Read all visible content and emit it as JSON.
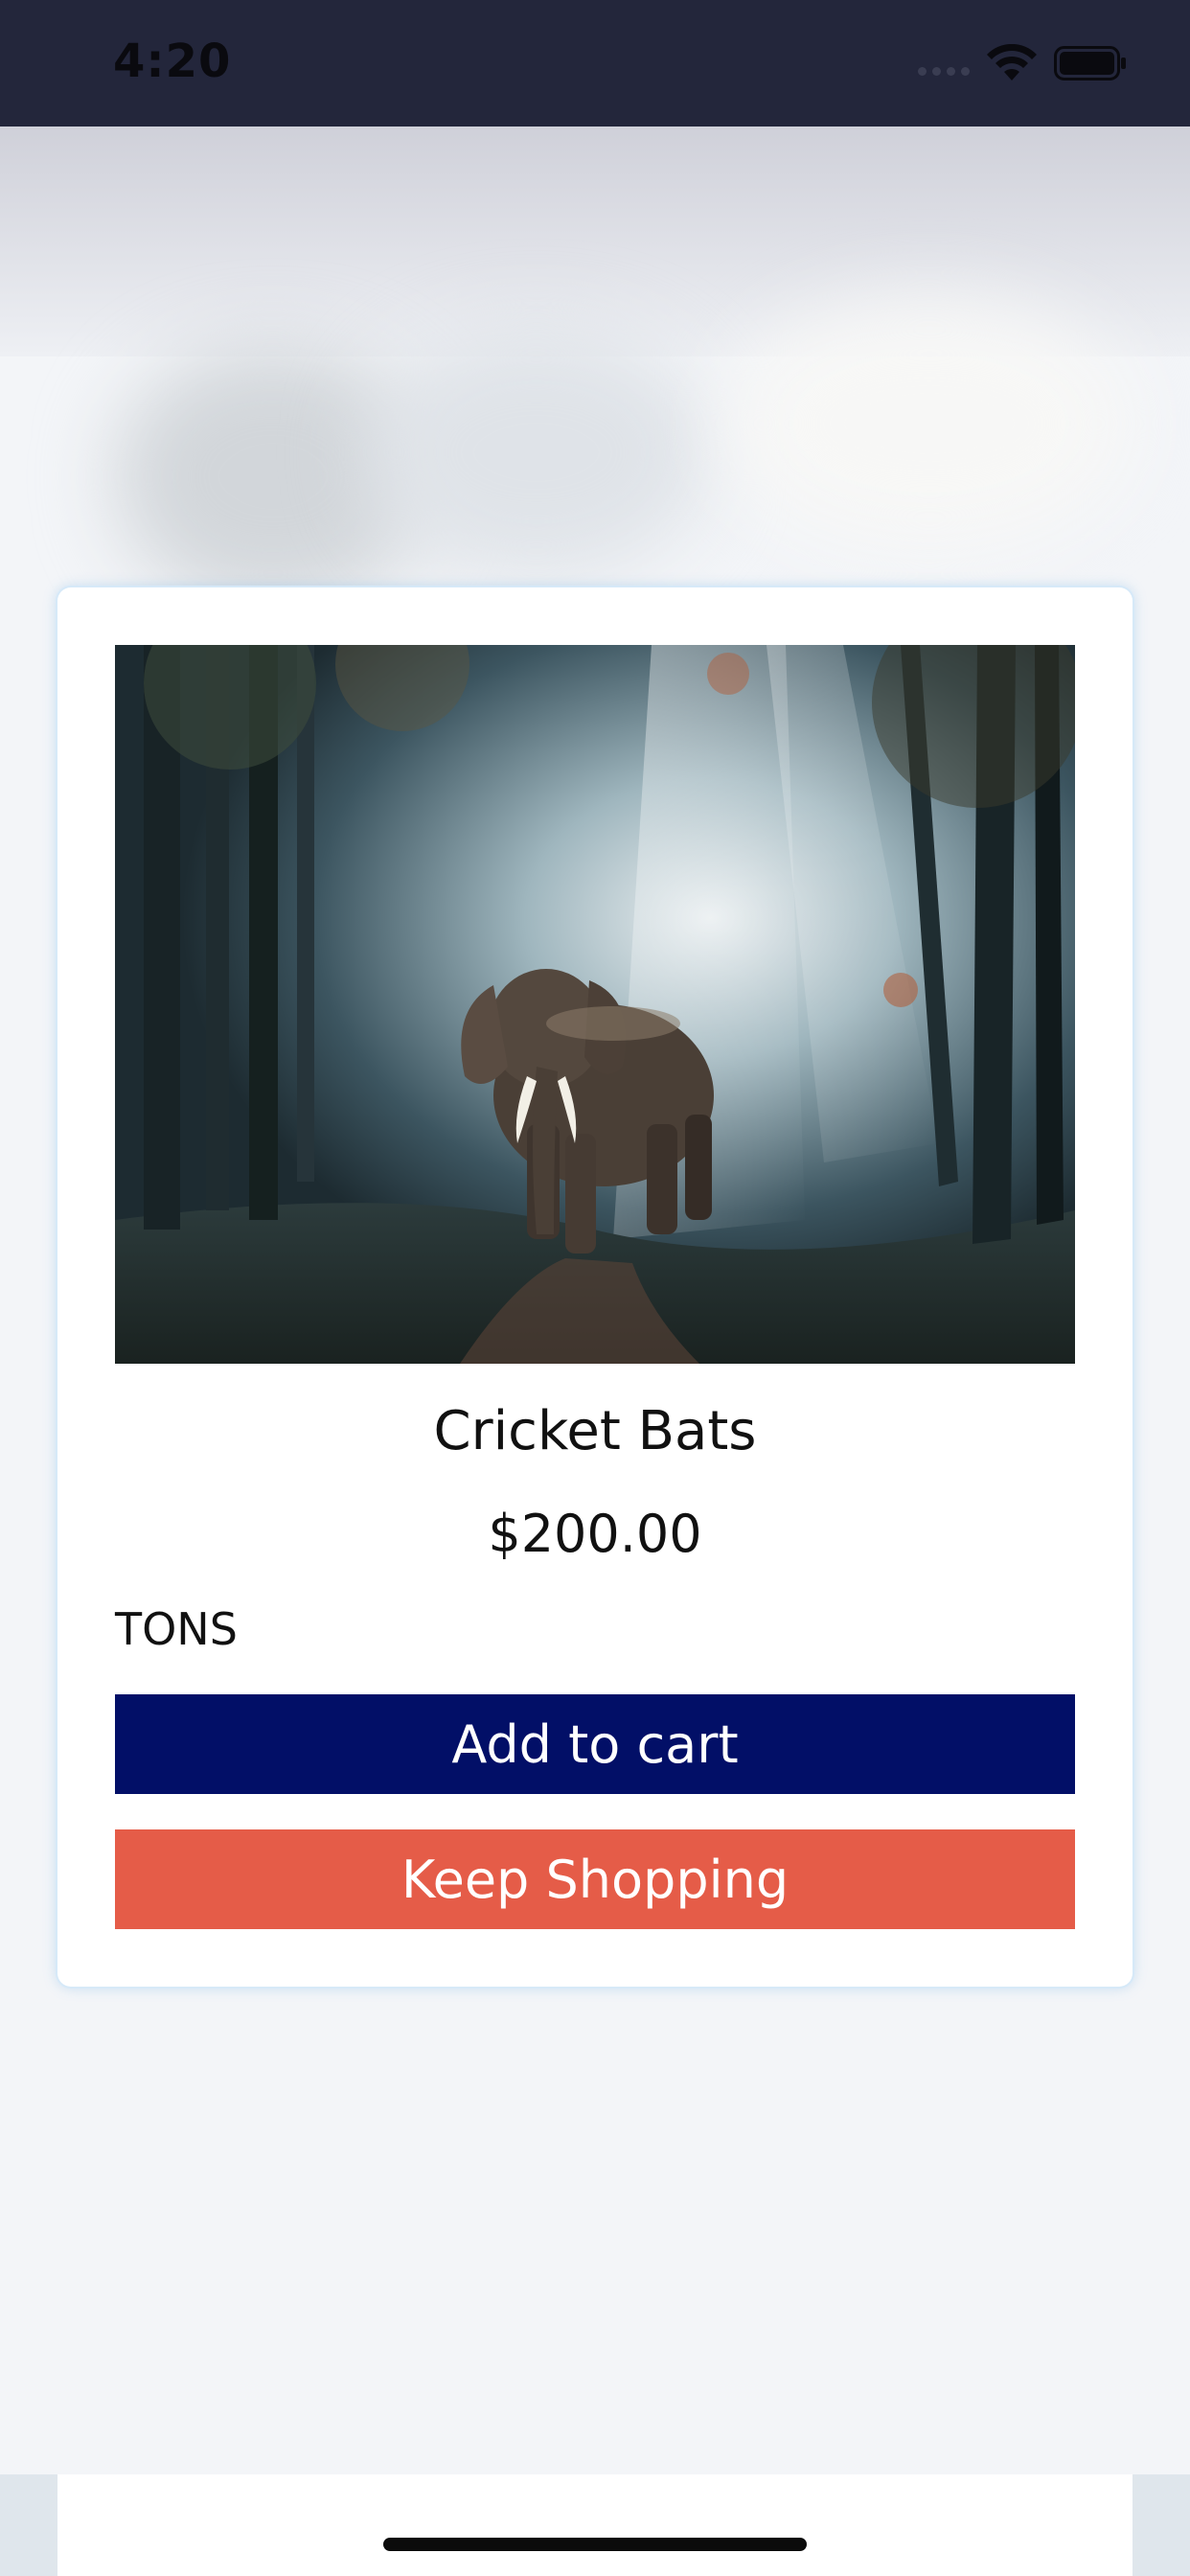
{
  "status_bar": {
    "time": "4:20",
    "icons": [
      "cellular-signal-icon",
      "wifi-icon",
      "battery-icon"
    ]
  },
  "product": {
    "image": "elephant-in-forest",
    "title": "Cricket Bats",
    "price": "$200.00",
    "brand": "TONS"
  },
  "actions": {
    "add_to_cart_label": "Add to cart",
    "keep_shopping_label": "Keep Shopping"
  },
  "colors": {
    "status_bar_bg": "#23263b",
    "add_to_cart_bg": "#020f67",
    "keep_shopping_bg": "#e55c48",
    "card_bg": "#ffffff"
  }
}
